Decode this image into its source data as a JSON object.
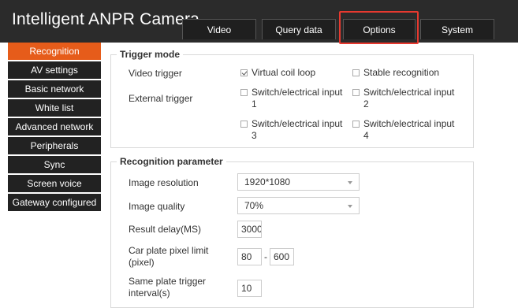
{
  "app": {
    "title": "Intelligent ANPR Camera"
  },
  "nav": {
    "tabs": [
      {
        "label": "Video"
      },
      {
        "label": "Query data"
      },
      {
        "label": "Options"
      },
      {
        "label": "System"
      }
    ],
    "highlight_color": "#e8392f"
  },
  "sidebar": {
    "active_color": "#e65c1a",
    "items": [
      {
        "label": "Recognition",
        "active": true
      },
      {
        "label": "AV settings"
      },
      {
        "label": "Basic network"
      },
      {
        "label": "White list"
      },
      {
        "label": "Advanced network"
      },
      {
        "label": "Peripherals"
      },
      {
        "label": "Sync"
      },
      {
        "label": "Screen voice"
      },
      {
        "label": "Gateway configured"
      }
    ]
  },
  "trigger_mode": {
    "title": "Trigger mode",
    "video_trigger": {
      "label": "Video trigger",
      "options": [
        {
          "label": "Virtual coil loop",
          "checked": true
        },
        {
          "label": "Stable recognition",
          "checked": false
        }
      ]
    },
    "external_trigger": {
      "label": "External trigger",
      "options": [
        {
          "label": "Switch/electrical input",
          "num": "1",
          "checked": false
        },
        {
          "label": "Switch/electrical input",
          "num": "2",
          "checked": false
        },
        {
          "label": "Switch/electrical input",
          "num": "3",
          "checked": false
        },
        {
          "label": "Switch/electrical input",
          "num": "4",
          "checked": false
        }
      ]
    }
  },
  "recognition_parameter": {
    "title": "Recognition parameter",
    "image_resolution": {
      "label": "Image resolution",
      "value": "1920*1080"
    },
    "image_quality": {
      "label": "Image quality",
      "value": "70%"
    },
    "result_delay": {
      "label": "Result delay(MS)",
      "value": "3000"
    },
    "plate_pixel_limit": {
      "label_line1": "Car plate pixel limit",
      "label_line2": "(pixel)",
      "min": "80",
      "separator": "-",
      "max": "600"
    },
    "same_plate_interval": {
      "label_line1": "Same plate trigger",
      "label_line2": "interval(s)",
      "value": "10"
    }
  }
}
